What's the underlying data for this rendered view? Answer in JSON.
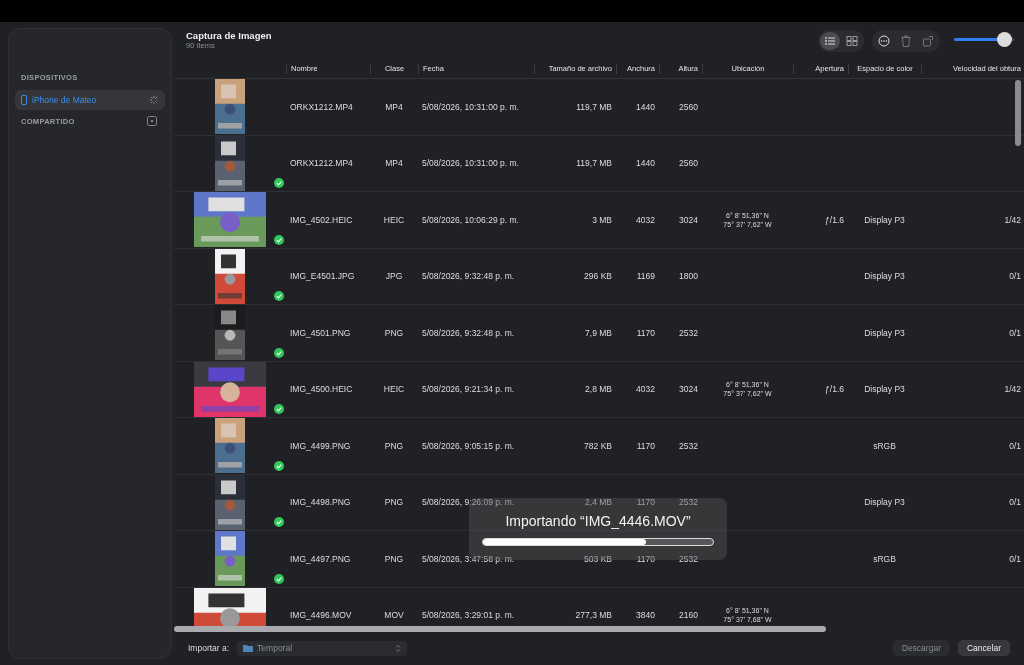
{
  "sidebar": {
    "sections": [
      {
        "title": "DISPOSITIVOS",
        "items": [
          {
            "label": "iPhone de Mateo",
            "selected": true,
            "loading": true
          }
        ]
      },
      {
        "title": "COMPARTIDO"
      }
    ]
  },
  "header": {
    "title": "Captura de Imagen",
    "subtitle": "90 ítems"
  },
  "toolbar": {
    "views": [
      {
        "kind": "list",
        "selected": true
      },
      {
        "kind": "grid",
        "selected": false
      }
    ],
    "thumbnail_size": {
      "level": 0.85
    }
  },
  "table": {
    "columns": [
      "Nombre",
      "Clase",
      "Fecha",
      "Tamaño de archivo",
      "Anchura",
      "Altura",
      "Ubicación",
      "Apertura",
      "Espacio de color",
      "Velocidad del obtura"
    ],
    "rows": [
      {
        "thumbnail": {
          "kind": "picture",
          "landscape": false
        },
        "imported": false,
        "cells": [
          "ORKX1212.MP4",
          "MP4",
          "5/08/2026, 10:31:00 p. m.",
          "119,7 MB",
          "1440",
          "2560",
          [
            "",
            ""
          ],
          "",
          "",
          ""
        ]
      },
      {
        "thumbnail": {
          "kind": "picture",
          "landscape": false
        },
        "imported": true,
        "cells": [
          "ORKX1212.MP4",
          "MP4",
          "5/08/2026, 10:31:00 p. m.",
          "119,7 MB",
          "1440",
          "2560",
          [
            "",
            ""
          ],
          "",
          "",
          ""
        ]
      },
      {
        "thumbnail": {
          "kind": "picture",
          "landscape": true
        },
        "imported": true,
        "cells": [
          "IMG_4502.HEIC",
          "HEIC",
          "5/08/2026, 10:06:29 p. m.",
          "3 MB",
          "4032",
          "3024",
          [
            "6° 8' 51,36\" N",
            "75° 37' 7,62\" W"
          ],
          "ƒ/1.6",
          "Display P3",
          "1/42"
        ]
      },
      {
        "thumbnail": {
          "kind": "picture",
          "landscape": false
        },
        "imported": true,
        "cells": [
          "IMG_E4501.JPG",
          "JPG",
          "5/08/2026, 9:32:48 p. m.",
          "296 KB",
          "1169",
          "1800",
          [
            "",
            ""
          ],
          "",
          "Display P3",
          "0/1"
        ]
      },
      {
        "thumbnail": {
          "kind": "picture",
          "landscape": false
        },
        "imported": true,
        "cells": [
          "IMG_4501.PNG",
          "PNG",
          "5/08/2026, 9:32:48 p. m.",
          "7,9 MB",
          "1170",
          "2532",
          [
            "",
            ""
          ],
          "",
          "Display P3",
          "0/1"
        ]
      },
      {
        "thumbnail": {
          "kind": "picture",
          "landscape": true
        },
        "imported": true,
        "cells": [
          "IMG_4500.HEIC",
          "HEIC",
          "5/08/2026, 9:21:34 p. m.",
          "2,8 MB",
          "4032",
          "3024",
          [
            "6° 8' 51,36\" N",
            "75° 37' 7,62\" W"
          ],
          "ƒ/1.6",
          "Display P3",
          "1/42"
        ]
      },
      {
        "thumbnail": {
          "kind": "picture",
          "landscape": false
        },
        "imported": true,
        "cells": [
          "IMG_4499.PNG",
          "PNG",
          "5/08/2026, 9:05:15 p. m.",
          "782 KB",
          "1170",
          "2532",
          [
            "",
            ""
          ],
          "",
          "sRGB",
          "0/1"
        ]
      },
      {
        "thumbnail": {
          "kind": "picture",
          "landscape": false
        },
        "imported": true,
        "cells": [
          "IMG_4498.PNG",
          "PNG",
          "5/08/2026, 9:26:09 p. m.",
          "2,4 MB",
          "1170",
          "2532",
          [
            "",
            ""
          ],
          "",
          "Display P3",
          "0/1"
        ]
      },
      {
        "thumbnail": {
          "kind": "picture",
          "landscape": false
        },
        "imported": true,
        "cells": [
          "IMG_4497.PNG",
          "PNG",
          "5/08/2026, 3:47:58 p. m.",
          "503 KB",
          "1170",
          "2532",
          [
            "",
            ""
          ],
          "",
          "sRGB",
          "0/1"
        ]
      },
      {
        "thumbnail": {
          "kind": "picture",
          "landscape": true
        },
        "imported": false,
        "cells": [
          "IMG_4496.MOV",
          "MOV",
          "5/08/2026, 3:29:01 p. m.",
          "277,3 MB",
          "3840",
          "2160",
          [
            "6° 8' 51,36\" N",
            "75° 37' 7,68\" W"
          ],
          "",
          "",
          ""
        ]
      }
    ]
  },
  "progress": {
    "title": "Importando “IMG_4446.MOV”",
    "level": 0.71
  },
  "footer": {
    "label": "Importar a:",
    "destination": {
      "value": "Temporal",
      "disabled": true
    },
    "buttons": [
      {
        "label": "Descargar",
        "disabled": true
      },
      {
        "label": "Cancelar",
        "disabled": false
      }
    ]
  }
}
